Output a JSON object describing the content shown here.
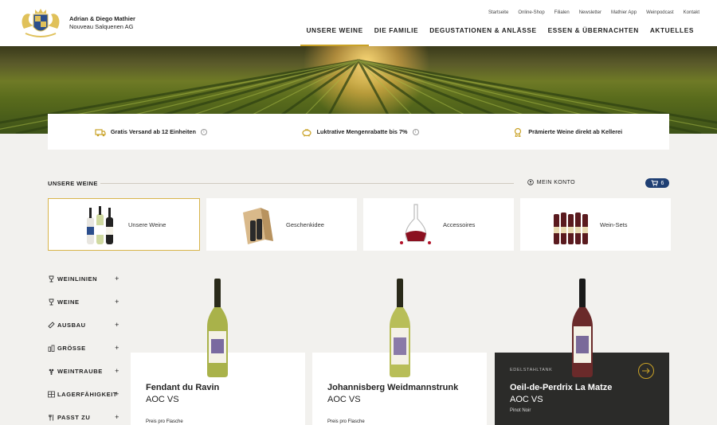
{
  "brand": {
    "line1": "Adrian & Diego Mathier",
    "line2": "Nouveau Salquenen AG"
  },
  "topnav": [
    "Startseite",
    "Online-Shop",
    "Filialen",
    "Newsletter",
    "Mathier App",
    "Weinpodcast",
    "Kontakt"
  ],
  "mainnav": [
    "UNSERE WEINE",
    "DIE FAMILIE",
    "DEGUSTATIONEN & ANLÄSSE",
    "ESSEN & ÜBERNACHTEN",
    "AKTUELLES"
  ],
  "features": [
    {
      "label": "Gratis Versand ab 12 Einheiten",
      "icon": "truck-icon"
    },
    {
      "label": "Luktrative Mengenrabatte bis 7%",
      "icon": "piggy-bank-icon"
    },
    {
      "label": "Prämierte Weine direkt ab Kellerei",
      "icon": "award-icon"
    }
  ],
  "section": {
    "title": "UNSERE WEINE",
    "account": "MEIN KONTO",
    "cart_count": "6"
  },
  "categories": [
    "Unsere Weine",
    "Geschenkidee",
    "Accessoires",
    "Wein-Sets"
  ],
  "filters": [
    "WEINLINIEN",
    "WEINE",
    "AUSBAU",
    "GRÖSSE",
    "WEINTRAUBE",
    "LAGERFÄHIGKEIT",
    "PASST ZU"
  ],
  "products": [
    {
      "name": "Fendant du Ravin",
      "aoc": "AOC VS",
      "price": "Preis pro Flasche"
    },
    {
      "name": "Johannisberg Weidmannstrunk",
      "aoc": "AOC VS",
      "price": "Preis pro Flasche"
    },
    {
      "name": "Oeil-de-Perdrix La Matze",
      "aoc": "AOC VS",
      "tag": "EDELSTAHLTANK",
      "variety": "Pinot Noir"
    }
  ],
  "colors": {
    "gold": "#c9a227",
    "navy": "#1f3f73",
    "dark": "#2b2b29"
  }
}
